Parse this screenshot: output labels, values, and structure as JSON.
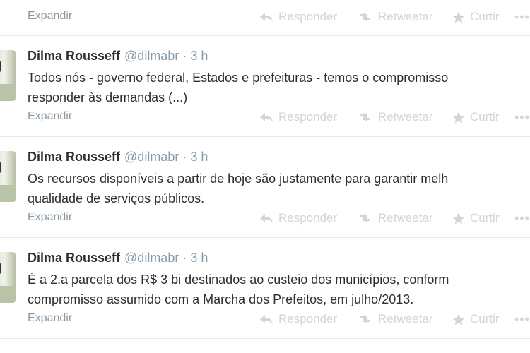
{
  "tweets": [
    {
      "expand_label": "Expandir",
      "actions": {
        "reply": "Responder",
        "retweet": "Retweetar",
        "favorite": "Curtir",
        "more": "•••"
      }
    },
    {
      "author_name": "Dilma Rousseff",
      "author_handle": "@dilmabr",
      "separator": "·",
      "time": "3 h",
      "text_lines": [
        "Todos nós - governo federal, Estados e prefeituras - temos o compromisso",
        "responder às demandas (...)"
      ],
      "expand_label": "Expandir",
      "actions": {
        "reply": "Responder",
        "retweet": "Retweetar",
        "favorite": "Curtir",
        "more": "•••"
      }
    },
    {
      "author_name": "Dilma Rousseff",
      "author_handle": "@dilmabr",
      "separator": "·",
      "time": "3 h",
      "text_lines": [
        "Os recursos disponíveis a partir de hoje são justamente para garantir melh",
        "qualidade de serviços públicos."
      ],
      "expand_label": "Expandir",
      "actions": {
        "reply": "Responder",
        "retweet": "Retweetar",
        "favorite": "Curtir",
        "more": "•••"
      }
    },
    {
      "author_name": "Dilma Rousseff",
      "author_handle": "@dilmabr",
      "separator": "·",
      "time": "3 h",
      "text_lines": [
        "É a 2.a parcela dos R$ 3 bi destinados ao custeio dos municípios, conform",
        "compromisso assumido com a Marcha dos Prefeitos, em julho/2013."
      ],
      "expand_label": "Expandir",
      "actions": {
        "reply": "Responder",
        "retweet": "Retweetar",
        "favorite": "Curtir",
        "more": "•••"
      }
    }
  ],
  "colors": {
    "text": "#292f33",
    "muted": "#8899a6",
    "action": "#cfd6dc",
    "divider": "#e8e8e8"
  },
  "icons": [
    "reply-icon",
    "retweet-icon",
    "star-icon",
    "more-icon",
    "avatar"
  ]
}
